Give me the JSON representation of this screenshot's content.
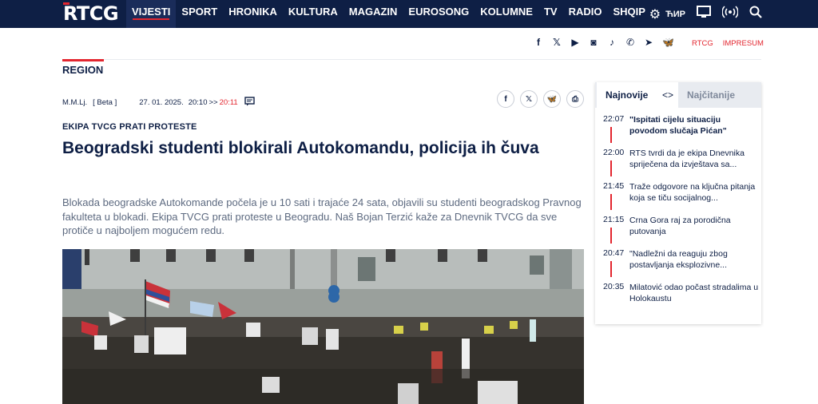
{
  "header": {
    "logo": "RTCG",
    "nav": [
      "VIJESTI",
      "SPORT",
      "HRONIKA",
      "KULTURA",
      "MAGAZIN",
      "EUROSONG",
      "KOLUMNE",
      "TV",
      "RADIO",
      "SHQIP"
    ],
    "active_nav": "VIJESTI",
    "lang_label": "ЋИР",
    "icons": [
      "gear-icon",
      "tv-icon",
      "live-radio-icon",
      "search-icon"
    ]
  },
  "social": {
    "icons": [
      "facebook-icon",
      "x-icon",
      "youtube-icon",
      "instagram-icon",
      "tiktok-icon",
      "viber-icon",
      "telegram-icon",
      "bluesky-icon"
    ],
    "links": [
      "RTCG",
      "IMPRESUM"
    ]
  },
  "section": "REGION",
  "article": {
    "author": "M.M.Lj.",
    "source": "[ Beta ]",
    "date": "27. 01. 2025.",
    "time": "20:10",
    "time_sep": ">>",
    "updated": "20:11",
    "kicker": "EKIPA TVCG PRATI PROTESTE",
    "title": "Beogradski studenti blokirali Autokomandu, policija ih čuva",
    "lead": "Blokada beogradske Autokomande počela je u 10 sati i trajaće 24 sata, objavili su studenti beogradskog Pravnog fakulteta u blokadi. Ekipa TVCG prati proteste u Beogradu. Naš Bojan Terzić kaže za Dnevnik TVCG da sve protiče u najboljem mogućem redu.",
    "share_icons": [
      "facebook-icon",
      "x-icon",
      "bluesky-icon",
      "print-icon"
    ]
  },
  "sidebar": {
    "tabs": [
      "Najnovije",
      "Najčitanije"
    ],
    "arrows": "<>",
    "items": [
      {
        "time": "22:07",
        "text": "\"Ispitati cijelu situaciju povodom slučaja Pićan\""
      },
      {
        "time": "22:00",
        "text": "RTS tvrdi da je ekipa Dnevnika spriječena da izvještava sa..."
      },
      {
        "time": "21:45",
        "text": "Traže odgovore na ključna pitanja koja se tiču socijalnog..."
      },
      {
        "time": "21:15",
        "text": "Crna Gora raj za porodična putovanja"
      },
      {
        "time": "20:47",
        "text": "\"Nadležni da reaguju zbog postavljanja eksplozivne..."
      },
      {
        "time": "20:35",
        "text": "Milatović odao počast stradalima u Holokaustu"
      }
    ]
  },
  "colors": {
    "navy": "#0e1f45",
    "accent": "#e3262f"
  }
}
